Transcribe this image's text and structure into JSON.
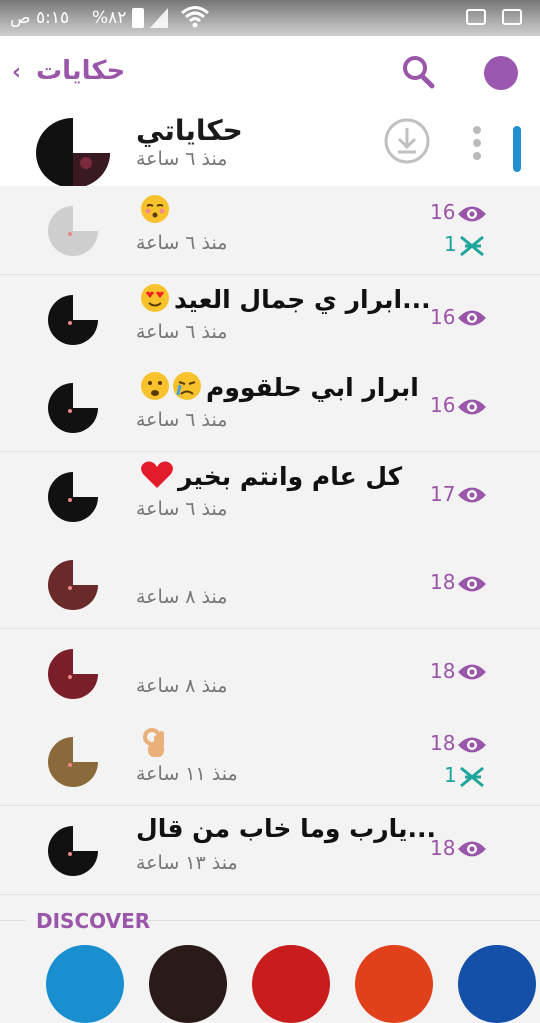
{
  "status_bar": {
    "time": "٥:١٥ ص",
    "battery": "%٨٢",
    "icons": [
      "signal-icon",
      "wifi-icon",
      "bbm-icon",
      "bbm-icon"
    ]
  },
  "header": {
    "back_label": "حكايات",
    "back_icon": "chevron-left-icon",
    "search_icon": "search-icon",
    "profile_color": "#9b58b0"
  },
  "my_story": {
    "title": "حكاياتي",
    "time": "منذ ٦ ساعة",
    "download_icon": "download-icon",
    "menu_icon": "menu-dots-icon"
  },
  "stories": [
    {
      "title": "",
      "emoji": "kiss-face",
      "time": "منذ ٦ ساعة",
      "views": "16",
      "shares": "1"
    },
    {
      "title": "ابرار ي جمال العيد...",
      "emoji": "heart-eyes",
      "time": "منذ ٦ ساعة",
      "views": "16",
      "shares": ""
    },
    {
      "title": "ابرار ابي حلقووم",
      "emoji": "crying-face",
      "time": "منذ ٦ ساعة",
      "views": "16",
      "shares": ""
    },
    {
      "title": "كل عام وانتم بخير",
      "emoji": "red-heart",
      "time": "منذ ٦ ساعة",
      "views": "17",
      "shares": ""
    },
    {
      "title": "",
      "emoji": "",
      "time": "منذ ٨ ساعة",
      "views": "18",
      "shares": ""
    },
    {
      "title": "",
      "emoji": "",
      "time": "منذ ٨ ساعة",
      "views": "18",
      "shares": ""
    },
    {
      "title": "",
      "emoji": "ok-hand",
      "time": "منذ ١١ ساعة",
      "views": "18",
      "shares": "1"
    },
    {
      "title": "يارب وما خاب من قال...",
      "emoji": "",
      "time": "منذ ١٣ ساعة",
      "views": "18",
      "shares": ""
    }
  ],
  "discover": {
    "label": "DISCOVER",
    "colors": [
      "#1a8fd0",
      "#2a1a1a",
      "#c91c1c",
      "#e0401a",
      "#1450a8"
    ]
  },
  "colors": {
    "accent": "#9a56a8",
    "share": "#1fa59a",
    "scroll": "#1f8fcf"
  }
}
